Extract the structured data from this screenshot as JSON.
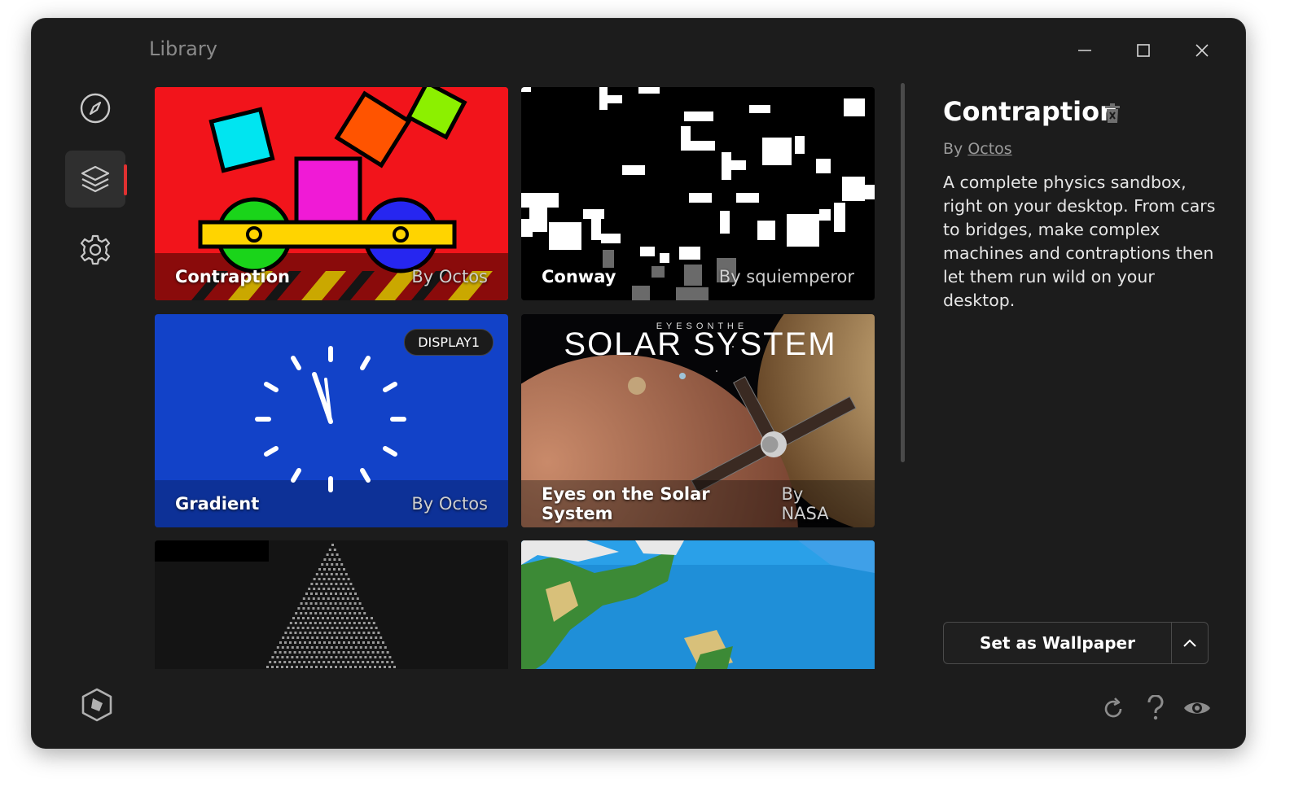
{
  "window": {
    "title": "Library"
  },
  "wallpapers": [
    {
      "title": "Contraption",
      "author": "By Octos"
    },
    {
      "title": "Conway",
      "author": "By squiemperor"
    },
    {
      "title": "Gradient",
      "author": "By Octos",
      "badge": "DISPLAY1"
    },
    {
      "title": "Eyes on the Solar System",
      "author": "By NASA",
      "banner_top": "E Y E S   O N   T H E",
      "banner_main": "SOLAR SYSTEM"
    },
    {
      "title": "",
      "author": ""
    },
    {
      "title": "",
      "author": ""
    }
  ],
  "detail": {
    "title": "Contraption",
    "by_prefix": "By",
    "author_link": "Octos",
    "description": "A complete physics sandbox, right on your desktop. From cars to bridges, make complex machines and contraptions then let them run wild on your desktop."
  },
  "actions": {
    "set_wallpaper": "Set as Wallpaper"
  },
  "icons": {
    "nav": [
      "compass-icon",
      "layers-icon",
      "gear-icon"
    ],
    "bottom_left": "app-logo-icon",
    "bottom_right": [
      "refresh-icon",
      "help-icon",
      "eye-icon"
    ]
  },
  "colors": {
    "accent": "#e03131",
    "background": "#1c1c1c"
  }
}
